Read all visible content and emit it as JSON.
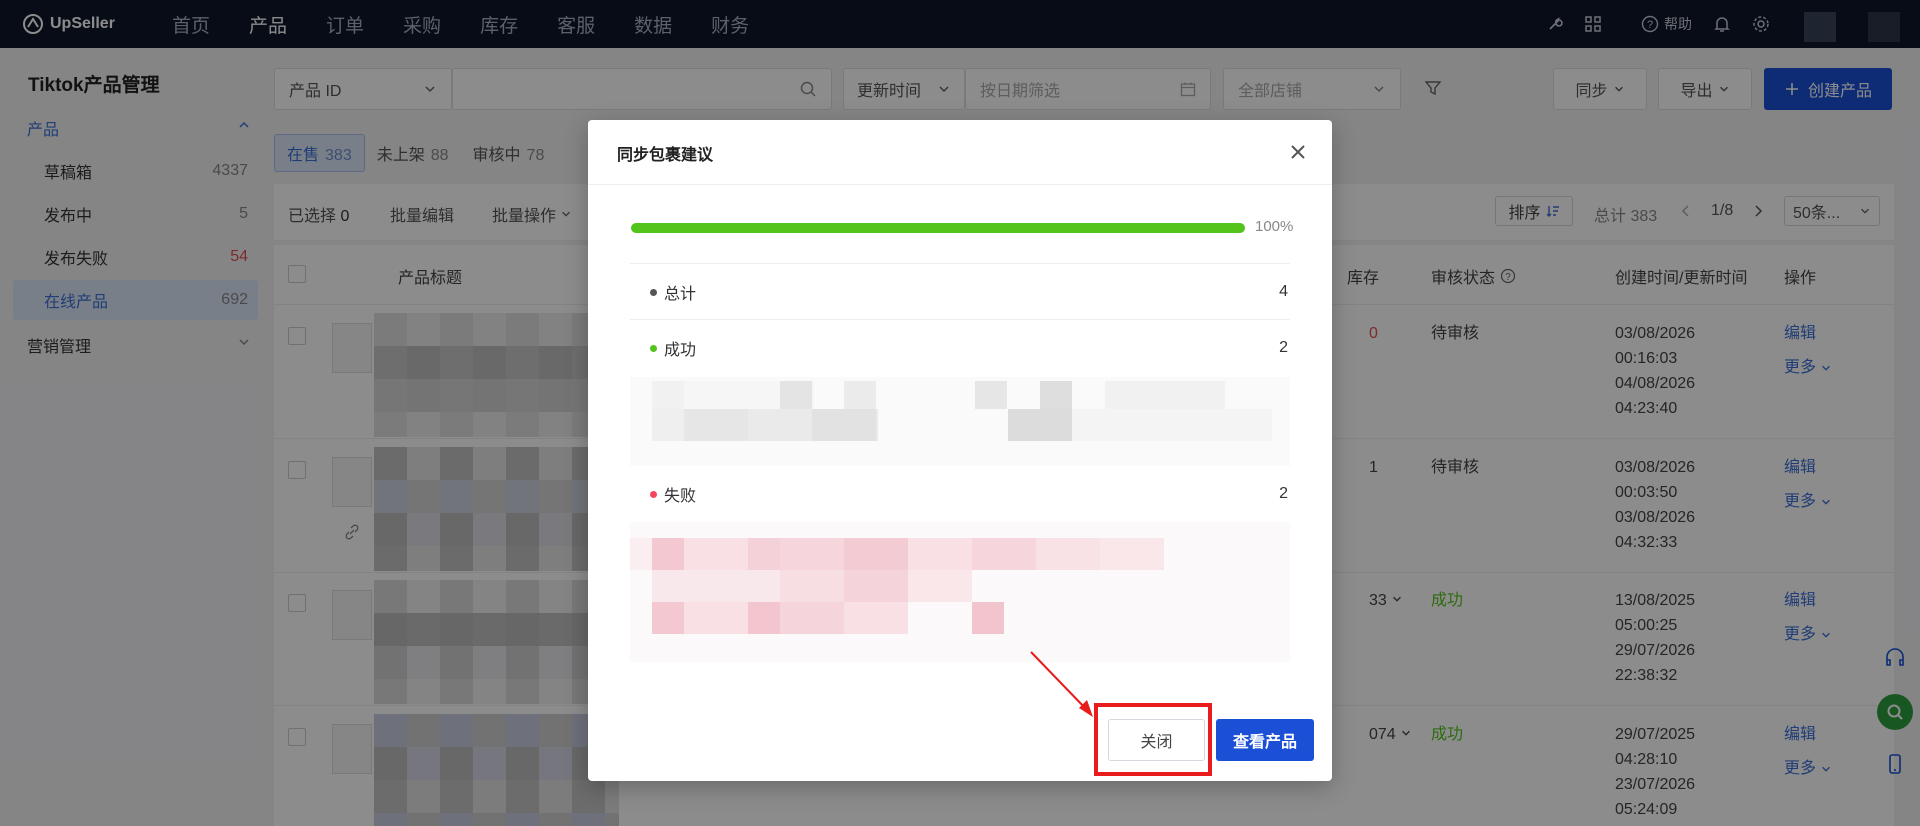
{
  "brand": {
    "name": "UpSeller"
  },
  "nav": {
    "items": [
      "首页",
      "产品",
      "订单",
      "采购",
      "库存",
      "客服",
      "数据",
      "财务"
    ],
    "active_index": 1,
    "help_label": "帮助"
  },
  "sidebar": {
    "title": "Tiktok产品管理",
    "group_product": "产品",
    "items": [
      {
        "label": "草稿箱",
        "count": "4337"
      },
      {
        "label": "发布中",
        "count": "5"
      },
      {
        "label": "发布失败",
        "count": "54"
      },
      {
        "label": "在线产品",
        "count": "692"
      }
    ],
    "group_marketing": "营销管理"
  },
  "toolbar": {
    "search_field": "产品 ID",
    "time_field": "更新时间",
    "date_placeholder": "按日期筛选",
    "store_placeholder": "全部店铺",
    "sync_label": "同步",
    "export_label": "导出",
    "create_label": "创建产品"
  },
  "status_tabs": [
    {
      "label": "在售",
      "count": "383"
    },
    {
      "label": "未上架",
      "count": "88"
    },
    {
      "label": "审核中",
      "count": "78"
    }
  ],
  "bulk_bar": {
    "selected_label": "已选择",
    "selected_count": "0",
    "bulk_edit": "批量编辑",
    "bulk_ops": "批量操作",
    "sort_label": "排序",
    "total_label": "总计 383",
    "page_label": "1/8",
    "page_size": "50条..."
  },
  "table": {
    "headers": {
      "title": "产品标题",
      "stock": "库存",
      "review": "审核状态",
      "time": "创建时间/更新时间",
      "ops": "操作"
    },
    "rows": [
      {
        "stock": "0",
        "status": "待审核",
        "created": "03/08/2026",
        "created_time": "00:16:03",
        "updated": "04/08/2026",
        "updated_time": "04:23:40",
        "edit": "编辑",
        "more": "更多"
      },
      {
        "stock": "1",
        "status": "待审核",
        "created": "03/08/2026",
        "created_time": "00:03:50",
        "updated": "03/08/2026",
        "updated_time": "04:32:33",
        "edit": "编辑",
        "more": "更多"
      },
      {
        "stock": "33",
        "status": "成功",
        "created": "13/08/2025",
        "created_time": "05:00:25",
        "updated": "29/07/2026",
        "updated_time": "22:38:32",
        "edit": "编辑",
        "more": "更多"
      },
      {
        "stock": "074",
        "status": "成功",
        "created": "29/07/2025",
        "created_time": "04:28:10",
        "updated": "23/07/2026",
        "updated_time": "05:24:09",
        "edit": "编辑",
        "more": "更多"
      }
    ]
  },
  "modal": {
    "title": "同步包裹建议",
    "progress": 100,
    "progress_label": "100%",
    "total_label": "总计",
    "total_value": "4",
    "success_label": "成功",
    "success_value": "2",
    "fail_label": "失败",
    "fail_value": "2",
    "close_label": "关闭",
    "view_label": "查看产品"
  },
  "colors": {
    "accent": "#1a4fd6",
    "success": "#52c41a",
    "danger": "#e34d4d",
    "highlight": "#e81c1c"
  }
}
